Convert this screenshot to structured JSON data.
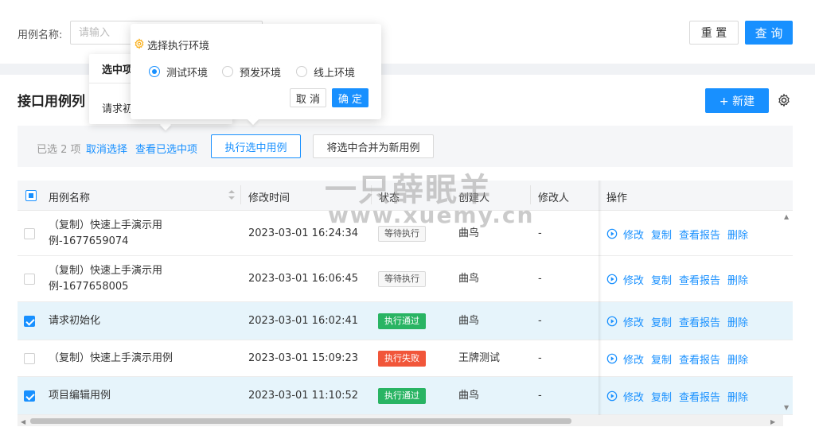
{
  "filter": {
    "name_label": "用例名称:",
    "name_placeholder": "请输入",
    "reset_label": "重 置",
    "query_label": "查 询"
  },
  "page": {
    "title": "接口用例列",
    "new_label": "+ 新建"
  },
  "selection": {
    "count_text": "已选 2 项",
    "cancel_label": "取消选择",
    "view_label": "查看已选中项",
    "execute_label": "执行选中用例",
    "merge_label": "将选中合并为新用例"
  },
  "table": {
    "headers": {
      "name": "用例名称",
      "modified": "修改时间",
      "status": "状态",
      "creator": "创建人",
      "modifier": "修改人",
      "ops": "操作"
    },
    "op_labels": {
      "edit": "修改",
      "copy": "复制",
      "report": "查看报告",
      "delete": "删除"
    },
    "rows": [
      {
        "name": "（复制）快速上手演示用例-1677659074",
        "modified": "2023-03-01 16:24:34",
        "status": "等待执行",
        "status_kind": "wait",
        "creator": "曲鸟",
        "modifier": "-",
        "checked": false
      },
      {
        "name": "（复制）快速上手演示用例-1677658005",
        "modified": "2023-03-01 16:06:45",
        "status": "等待执行",
        "status_kind": "wait",
        "creator": "曲鸟",
        "modifier": "-",
        "checked": false
      },
      {
        "name": "请求初始化",
        "modified": "2023-03-01 16:02:41",
        "status": "执行通过",
        "status_kind": "pass",
        "creator": "曲鸟",
        "modifier": "-",
        "checked": true
      },
      {
        "name": "（复制）快速上手演示用例",
        "modified": "2023-03-01 15:09:23",
        "status": "执行失败",
        "status_kind": "fail",
        "creator": "王牌测试",
        "modifier": "-",
        "checked": false
      },
      {
        "name": "项目编辑用例",
        "modified": "2023-03-01 11:10:52",
        "status": "执行通过",
        "status_kind": "pass",
        "creator": "曲鸟",
        "modifier": "-",
        "checked": true
      }
    ]
  },
  "behind_popover": {
    "title": "选中项",
    "item": "请求初"
  },
  "env_popover": {
    "title": "选择执行环境",
    "options": [
      "测试环境",
      "预发环境",
      "线上环境"
    ],
    "selected": "测试环境",
    "cancel_label": "取 消",
    "ok_label": "确 定"
  },
  "watermark": {
    "line1": "一只薛眠羊",
    "line2": "www.xuemy.cn"
  },
  "colors": {
    "primary": "#1890ff",
    "pass": "#29b463",
    "fail": "#f1563a",
    "row_selected": "#e6f4fb"
  }
}
